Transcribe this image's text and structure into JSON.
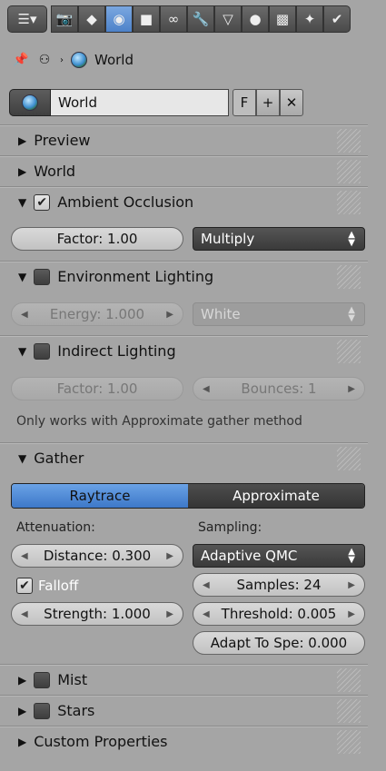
{
  "toolbar": {
    "buttons": [
      "render-type",
      "render",
      "render-layers",
      "scene",
      "world",
      "object",
      "constraints",
      "modifiers",
      "data",
      "material",
      "texture",
      "particles",
      "physics"
    ]
  },
  "breadcrumb": {
    "world_label": "World"
  },
  "world_block": {
    "name_value": "World",
    "fake_user": "F",
    "add": "+",
    "unlink": "✕"
  },
  "panels": {
    "preview": {
      "label": "Preview"
    },
    "world": {
      "label": "World"
    },
    "ambient_occlusion": {
      "label": "Ambient Occlusion",
      "factor": "Factor: 1.00",
      "blend": "Multiply"
    },
    "environment_lighting": {
      "label": "Environment Lighting",
      "energy": "Energy: 1.000",
      "color": "White"
    },
    "indirect_lighting": {
      "label": "Indirect Lighting",
      "factor": "Factor: 1.00",
      "bounces": "Bounces: 1",
      "note": "Only works with Approximate gather method"
    },
    "gather": {
      "label": "Gather",
      "mode_raytrace": "Raytrace",
      "mode_approximate": "Approximate",
      "attenuation_label": "Attenuation:",
      "sampling_label": "Sampling:",
      "distance": "Distance: 0.300",
      "falloff": "Falloff",
      "strength": "Strength: 1.000",
      "sampling_method": "Adaptive QMC",
      "samples": "Samples: 24",
      "threshold": "Threshold: 0.005",
      "adapt": "Adapt To Spe: 0.000"
    },
    "mist": {
      "label": "Mist"
    },
    "stars": {
      "label": "Stars"
    },
    "custom_properties": {
      "label": "Custom Properties"
    }
  }
}
